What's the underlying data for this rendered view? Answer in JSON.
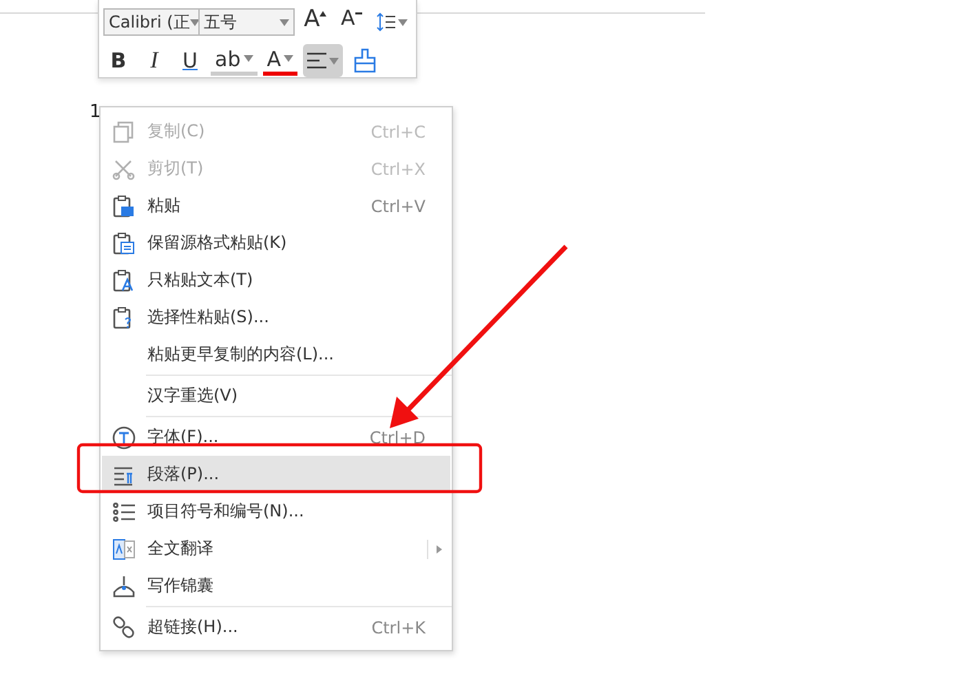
{
  "toolbar": {
    "font": "Calibri (正",
    "size": "五号",
    "row1": [
      {
        "kind": "grow",
        "glyph": "A"
      },
      {
        "kind": "shrink",
        "glyph": "A"
      },
      {
        "kind": "spacing"
      }
    ],
    "row2": [
      {
        "kind": "bold",
        "glyph": "B",
        "selected": false
      },
      {
        "kind": "italic",
        "glyph": "I",
        "selected": false
      },
      {
        "kind": "underline",
        "glyph": "U",
        "selected": false
      },
      {
        "kind": "highlight",
        "glyph": "ab",
        "selected": false
      },
      {
        "kind": "color",
        "glyph": "A",
        "selected": false
      },
      {
        "kind": "align",
        "selected": true
      },
      {
        "kind": "painter",
        "selected": false
      }
    ]
  },
  "document": {
    "lines": [
      "1"
    ]
  },
  "context_menu": {
    "items": [
      {
        "kind": "copy",
        "label": "复制(C)",
        "shortcut": "Ctrl+C",
        "disabled": true,
        "selected": false
      },
      {
        "kind": "cut",
        "label": "剪切(T)",
        "shortcut": "Ctrl+X",
        "disabled": true,
        "selected": false
      },
      {
        "kind": "paste",
        "label": "粘贴",
        "shortcut": "Ctrl+V",
        "disabled": false,
        "selected": false
      },
      {
        "kind": "paste-format",
        "label": "保留源格式粘贴(K)",
        "disabled": false,
        "selected": false
      },
      {
        "kind": "paste-text",
        "label": "只粘贴文本(T)",
        "disabled": false,
        "selected": false
      },
      {
        "kind": "paste-special",
        "label": "选择性粘贴(S)...",
        "disabled": false,
        "selected": false
      },
      {
        "kind": "plain",
        "label": "粘贴更早复制的内容(L)...",
        "disabled": false,
        "selected": false
      },
      {
        "kind": "separator"
      },
      {
        "kind": "plain",
        "label": "汉字重选(V)",
        "disabled": false,
        "selected": false
      },
      {
        "kind": "separator"
      },
      {
        "kind": "font",
        "label": "字体(F)...",
        "shortcut": "Ctrl+D",
        "disabled": false,
        "selected": false
      },
      {
        "kind": "paragraph",
        "label": "段落(P)...",
        "disabled": false,
        "selected": true
      },
      {
        "kind": "list",
        "label": "项目符号和编号(N)...",
        "disabled": false,
        "selected": false
      },
      {
        "kind": "translate",
        "label": "全文翻译",
        "submenu": true,
        "disabled": false,
        "selected": false
      },
      {
        "kind": "pen",
        "label": "写作锦囊",
        "disabled": false,
        "selected": false
      },
      {
        "kind": "separator"
      },
      {
        "kind": "link",
        "label": "超链接(H)...",
        "shortcut": "Ctrl+K",
        "disabled": false,
        "selected": false
      }
    ]
  }
}
